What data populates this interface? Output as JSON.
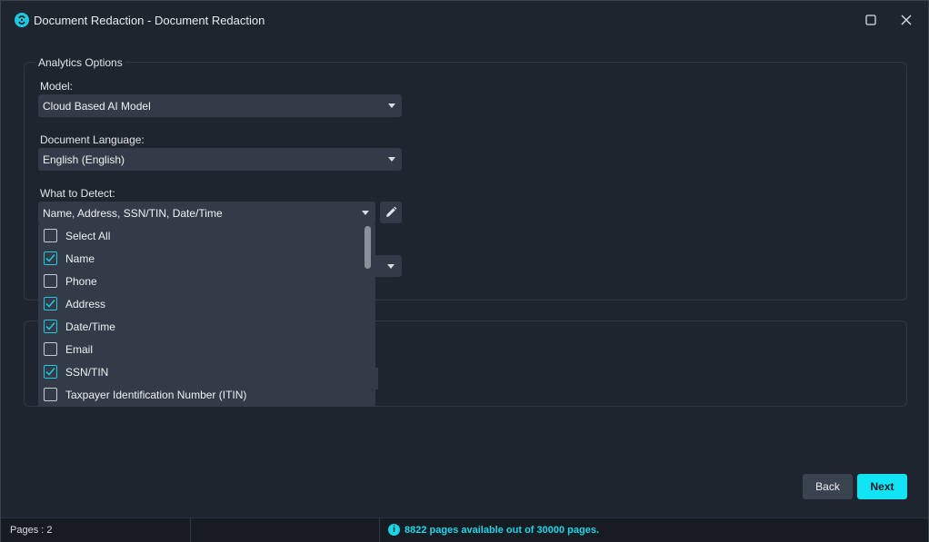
{
  "window": {
    "title": "Document Redaction - Document Redaction"
  },
  "analytics": {
    "group_title": "Analytics Options",
    "model_label": "Model:",
    "model_value": "Cloud Based AI Model",
    "language_label": "Document Language:",
    "language_value": "English (English)",
    "detect_label": "What to Detect:",
    "detect_value": "Name, Address, SSN/TIN, Date/Time"
  },
  "detect_options": [
    {
      "label": "Select All",
      "checked": false
    },
    {
      "label": "Name",
      "checked": true
    },
    {
      "label": "Phone",
      "checked": false
    },
    {
      "label": "Address",
      "checked": true
    },
    {
      "label": "Date/Time",
      "checked": true
    },
    {
      "label": "Email",
      "checked": false
    },
    {
      "label": "SSN/TIN",
      "checked": true
    },
    {
      "label": "Taxpayer Identification Number (ITIN)",
      "checked": false
    }
  ],
  "buttons": {
    "back": "Back",
    "next": "Next"
  },
  "status": {
    "pages": "Pages : 2",
    "availability": "8822 pages available out of 30000 pages."
  },
  "colors": {
    "accent": "#10e4f4",
    "panel": "#323b47",
    "background": "#1f252e"
  },
  "icons": {
    "app": "app-logo-icon",
    "maximize": "maximize-icon",
    "close": "close-icon",
    "edit": "pencil-icon",
    "info": "info-icon"
  }
}
